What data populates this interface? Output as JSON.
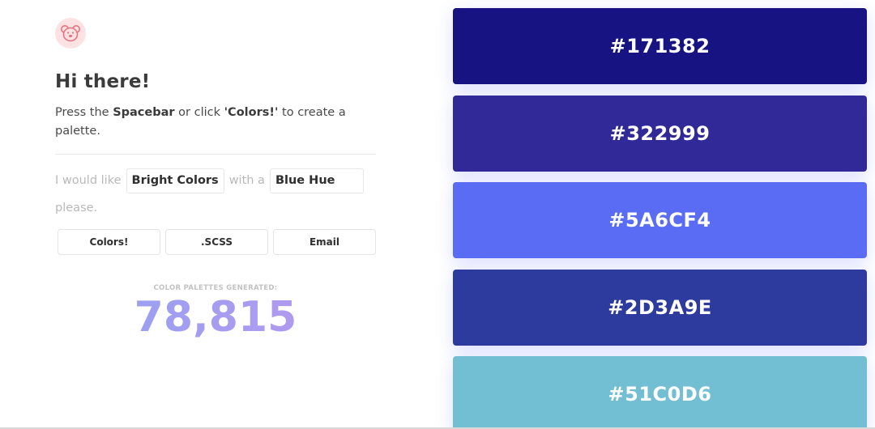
{
  "logo": {
    "icon": "koala-icon"
  },
  "heading": "Hi there!",
  "intro": {
    "press": "Press the ",
    "spacebar": "Spacebar",
    "or_click": " or click ",
    "colors_quote": "'Colors!'",
    "to_create": " to create a palette."
  },
  "prefs": {
    "i_would_like": "I would like",
    "brightness_value": "Bright Colors",
    "with_a": "with a",
    "hue_value": "Blue Hue",
    "please": "please."
  },
  "actions": {
    "colors": "Colors!",
    "scss": ".SCSS",
    "email": "Email"
  },
  "counter": {
    "label": "COLOR PALETTES GENERATED:",
    "value": "78,815"
  },
  "swatches": [
    {
      "hex": "#171382",
      "color": "#171382"
    },
    {
      "hex": "#322999",
      "color": "#322999"
    },
    {
      "hex": "#5A6CF4",
      "color": "#5A6CF4"
    },
    {
      "hex": "#2D3A9E",
      "color": "#2D3A9E"
    },
    {
      "hex": "#51C0D6",
      "color": "#72BFD4"
    }
  ]
}
